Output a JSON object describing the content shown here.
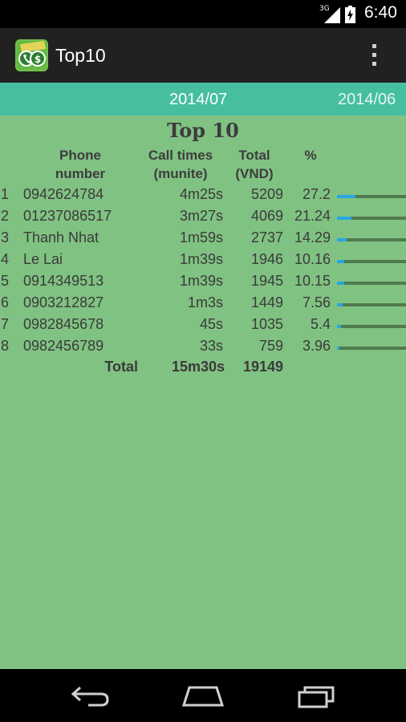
{
  "status_bar": {
    "network": "3G",
    "time": "6:40"
  },
  "action_bar": {
    "title": "Top10"
  },
  "tabs": {
    "current": "2014/07",
    "next": "2014/06"
  },
  "table": {
    "title": "Top 10",
    "headers": {
      "phone": "Phone number",
      "call_times": "Call times (munite)",
      "total": "Total (VND)",
      "percent": "%"
    },
    "rows": [
      {
        "rank": "1",
        "name": "0942624784",
        "time": "4m25s",
        "total": "5209",
        "percent": "27.2",
        "pct": 27.2
      },
      {
        "rank": "2",
        "name": "01237086517",
        "time": "3m27s",
        "total": "4069",
        "percent": "21.24",
        "pct": 21.24
      },
      {
        "rank": "3",
        "name": "Thanh Nhat",
        "time": "1m59s",
        "total": "2737",
        "percent": "14.29",
        "pct": 14.29
      },
      {
        "rank": "4",
        "name": "Le Lai",
        "time": "1m39s",
        "total": "1946",
        "percent": "10.16",
        "pct": 10.16
      },
      {
        "rank": "5",
        "name": "0914349513",
        "time": "1m39s",
        "total": "1945",
        "percent": "10.15",
        "pct": 10.15
      },
      {
        "rank": "6",
        "name": "0903212827",
        "time": "1m3s",
        "total": "1449",
        "percent": "7.56",
        "pct": 7.56
      },
      {
        "rank": "7",
        "name": "0982845678",
        "time": "45s",
        "total": "1035",
        "percent": "5.4",
        "pct": 5.4
      },
      {
        "rank": "8",
        "name": "0982456789",
        "time": "33s",
        "total": "759",
        "percent": "3.96",
        "pct": 3.96
      }
    ],
    "totals": {
      "label": "Total",
      "time": "15m30s",
      "total": "19149"
    }
  },
  "colors": {
    "accent": "#46bfa0",
    "background": "#80c282",
    "bar_fill": "#29a6e0",
    "bar_track": "#4f7a4f"
  },
  "icons": {
    "app": "money-phone-icon",
    "overflow": "overflow-menu-icon",
    "back": "back-icon",
    "home": "home-icon",
    "recents": "recents-icon"
  }
}
